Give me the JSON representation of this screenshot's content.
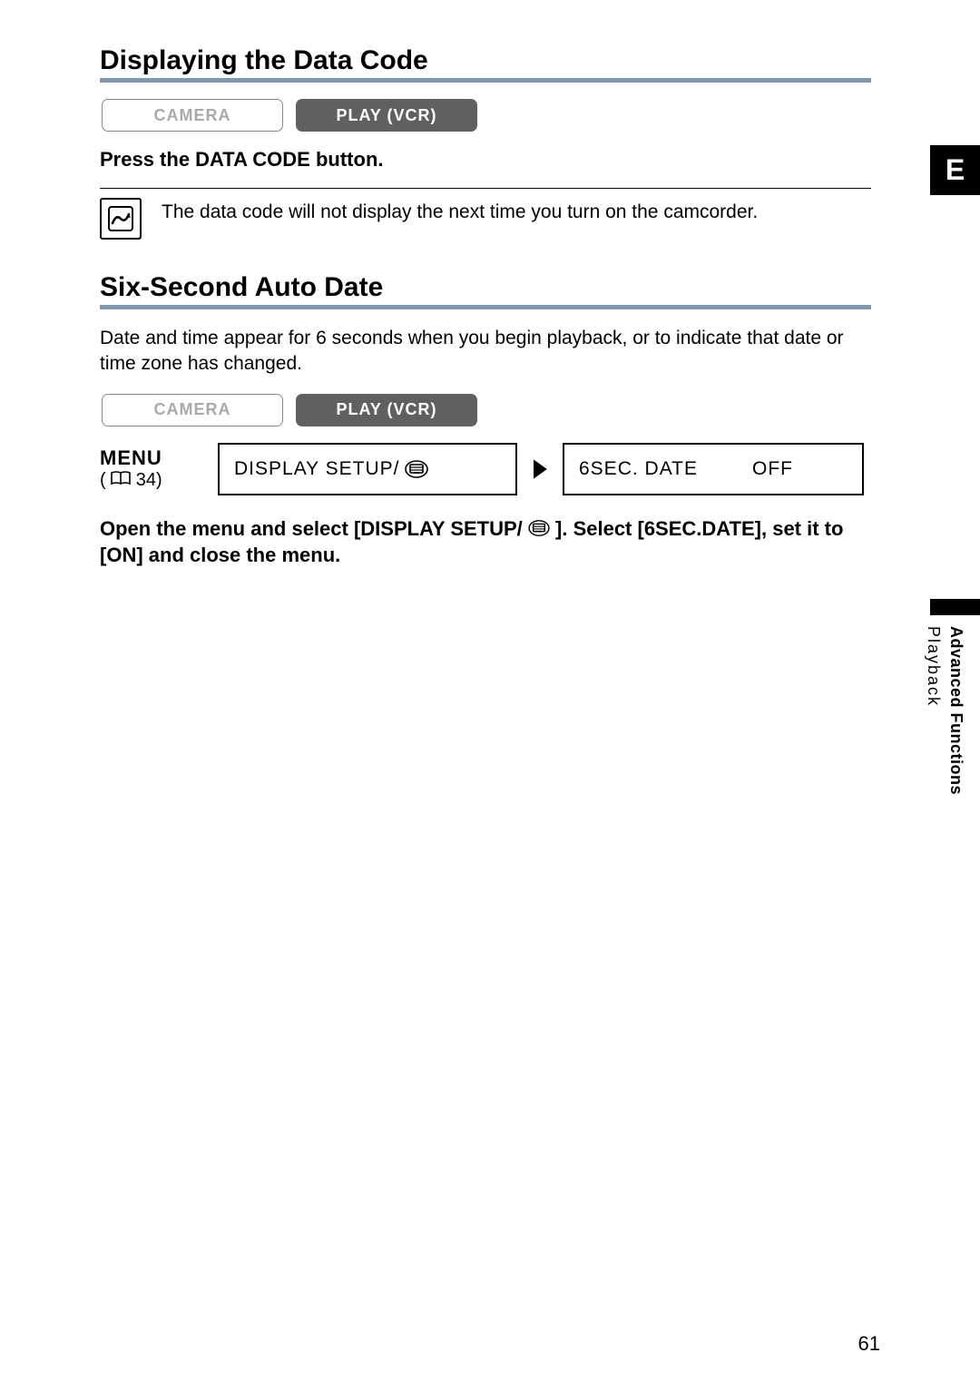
{
  "side": {
    "tab": "E",
    "line1": "Advanced Functions",
    "line2": "Playback"
  },
  "page_number": "61",
  "section1": {
    "title": "Displaying the Data Code",
    "modes": {
      "camera": "CAMERA",
      "play": "PLAY (VCR)"
    },
    "instruction": "Press the DATA CODE button.",
    "note": "The data code will not display the next time you turn on the camcorder."
  },
  "section2": {
    "title": "Six-Second Auto Date",
    "intro": "Date and time appear for 6 seconds when you begin playback, or to indicate that date or time zone has changed.",
    "modes": {
      "camera": "CAMERA",
      "play": "PLAY (VCR)"
    },
    "menu": {
      "label": "MENU",
      "page_ref": "34",
      "box1": "DISPLAY SETUP/",
      "box2_item": "6SEC. DATE",
      "box2_value": "OFF"
    },
    "final_pre": "Open the menu and select [DISPLAY SETUP/ ",
    "final_post": " ]. Select [6SEC.DATE], set it to [ON] and close the menu."
  }
}
